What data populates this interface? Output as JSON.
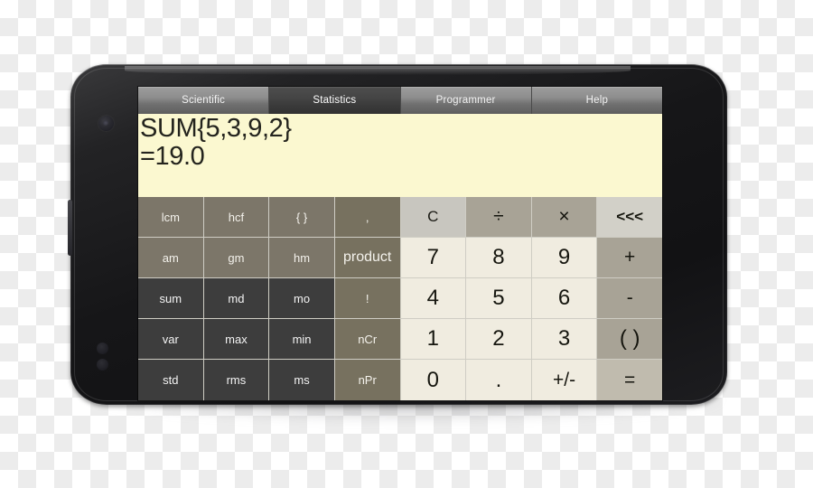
{
  "app": {
    "name": "Calculator",
    "device": "smartphone-landscape",
    "background": "transparency-checkerboard"
  },
  "tabs": [
    {
      "label": "Scientific",
      "active": false
    },
    {
      "label": "Statistics",
      "active": true
    },
    {
      "label": "Programmer",
      "active": false
    },
    {
      "label": "Help",
      "active": false
    }
  ],
  "display": {
    "expression": "SUM{5,3,9,2}",
    "result": "=19.0",
    "background_color": "#fbf8d0",
    "text_color": "#24241e"
  },
  "keypad": {
    "rows": [
      [
        {
          "label": "lcm",
          "style": "k-taupe"
        },
        {
          "label": "hcf",
          "style": "k-taupe"
        },
        {
          "label": "{ }",
          "style": "k-taupe"
        },
        {
          "label": ",",
          "style": "k-taupe2"
        },
        {
          "label": "C",
          "style": "k-clear"
        },
        {
          "label": "÷",
          "style": "k-op"
        },
        {
          "label": "×",
          "style": "k-op"
        },
        {
          "label": "<<<",
          "style": "k-back"
        }
      ],
      [
        {
          "label": "am",
          "style": "k-taupe"
        },
        {
          "label": "gm",
          "style": "k-taupe"
        },
        {
          "label": "hm",
          "style": "k-taupe"
        },
        {
          "label": "product",
          "style": "k-taupe2 k-small"
        },
        {
          "label": "7",
          "style": "k-num"
        },
        {
          "label": "8",
          "style": "k-num"
        },
        {
          "label": "9",
          "style": "k-num"
        },
        {
          "label": "+",
          "style": "k-op"
        }
      ],
      [
        {
          "label": "sum",
          "style": "k-dark"
        },
        {
          "label": "md",
          "style": "k-dark"
        },
        {
          "label": "mo",
          "style": "k-dark"
        },
        {
          "label": "!",
          "style": "k-taupe2"
        },
        {
          "label": "4",
          "style": "k-num"
        },
        {
          "label": "5",
          "style": "k-num"
        },
        {
          "label": "6",
          "style": "k-num"
        },
        {
          "label": "-",
          "style": "k-op"
        }
      ],
      [
        {
          "label": "var",
          "style": "k-dark"
        },
        {
          "label": "max",
          "style": "k-dark"
        },
        {
          "label": "min",
          "style": "k-dark"
        },
        {
          "label": "nCr",
          "style": "k-taupe2"
        },
        {
          "label": "1",
          "style": "k-num"
        },
        {
          "label": "2",
          "style": "k-num"
        },
        {
          "label": "3",
          "style": "k-num"
        },
        {
          "label": "( )",
          "style": "k-paren"
        }
      ],
      [
        {
          "label": "std",
          "style": "k-dark"
        },
        {
          "label": "rms",
          "style": "k-dark"
        },
        {
          "label": "ms",
          "style": "k-dark"
        },
        {
          "label": "nPr",
          "style": "k-taupe2"
        },
        {
          "label": "0",
          "style": "k-num"
        },
        {
          "label": ".",
          "style": "k-num"
        },
        {
          "label": "+/-",
          "style": "k-pm"
        },
        {
          "label": "=",
          "style": "k-eq"
        }
      ]
    ]
  },
  "colors": {
    "display_bg": "#fbf8d0",
    "function_key_taupe": "#7c7669",
    "function_key_dark": "#3d3d3d",
    "number_key": "#f0ece0",
    "operator_key": "#a8a396",
    "tab_active": "#444444",
    "device_body": "#161618"
  }
}
